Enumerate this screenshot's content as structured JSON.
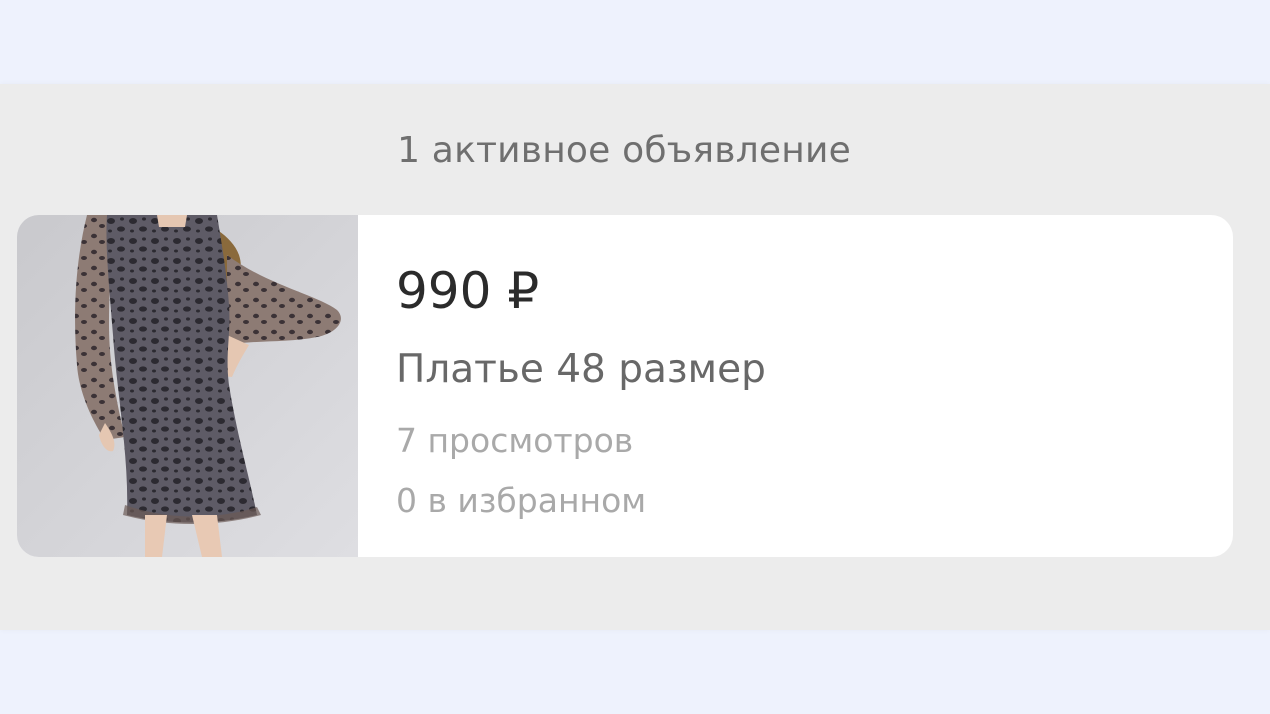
{
  "summary": {
    "active_listings_label": "1 активное объявление"
  },
  "listing": {
    "image_icon": "dress-photo",
    "price": "990 ₽",
    "title": "Платье 48 размер",
    "views": "7 просмотров",
    "favorites": "0 в избранном"
  },
  "colors": {
    "page_background": "#eef2fd",
    "panel_background": "#ececec",
    "card_background": "#ffffff"
  }
}
